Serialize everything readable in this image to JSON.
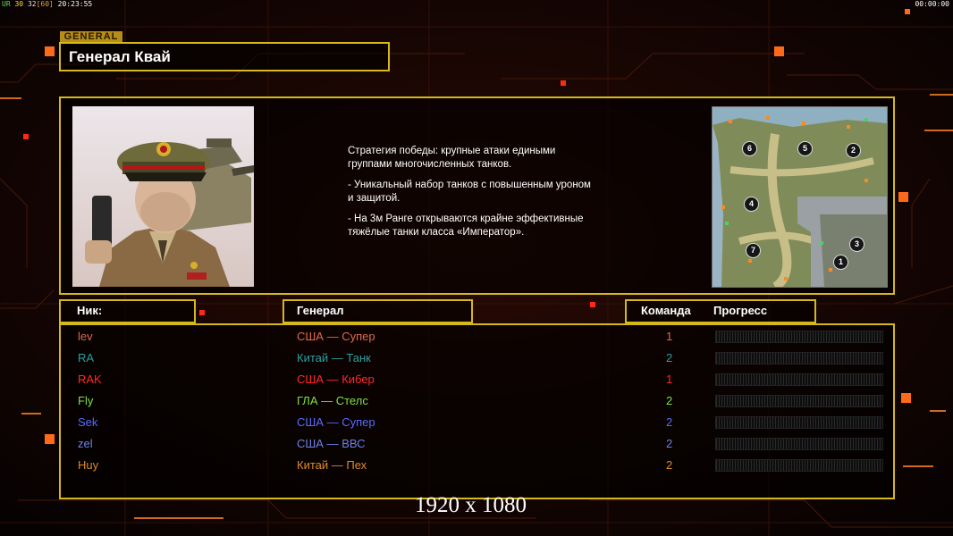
{
  "hud": {
    "indicator": "UR",
    "value_a": "30",
    "value_b": "32",
    "value_c": "[60]",
    "clock": "20:23:55",
    "timer": "00:00:00"
  },
  "general_panel": {
    "tag": "GENERAL",
    "title": "Генерал Квай",
    "description": [
      "Стратегия победы: крупные атаки едиными\n группами многочисленных танков.",
      "- Уникальный набор танков с повышенным уроном\n и защитой.",
      "- На 3м Ранге открываются крайне эффективные\n тяжёлые танки класса «Император»."
    ],
    "map_positions": [
      "6",
      "5",
      "2",
      "4",
      "7",
      "3",
      "1"
    ]
  },
  "players_table": {
    "headers": {
      "nick": "Ник:",
      "general": "Генерал",
      "team": "Команда",
      "progress": "Прогресс"
    },
    "rows": [
      {
        "nick": "lev",
        "general": "США — Супер",
        "team": "1",
        "color": "#e06a4a"
      },
      {
        "nick": "RA",
        "general": "Китай — Танк",
        "team": "2",
        "color": "#2aa0a0"
      },
      {
        "nick": "RAK",
        "general": "США — Кибер",
        "team": "1",
        "color": "#ff2a2a"
      },
      {
        "nick": "Fly",
        "general": "ГЛА — Стелс",
        "team": "2",
        "color": "#80e040"
      },
      {
        "nick": "Sek",
        "general": "США — Супер",
        "team": "2",
        "color": "#5a6aff"
      },
      {
        "nick": "zel",
        "general": "США — ВВС",
        "team": "2",
        "color": "#7080e8"
      },
      {
        "nick": "Huy",
        "general": "Китай — Пех",
        "team": "2",
        "color": "#e08a2a"
      }
    ]
  },
  "resolution_label": "1920 x 1080",
  "colors": {
    "frame": "#d5b91b",
    "accent": "#ff6a1a",
    "background": "#0a0303"
  }
}
